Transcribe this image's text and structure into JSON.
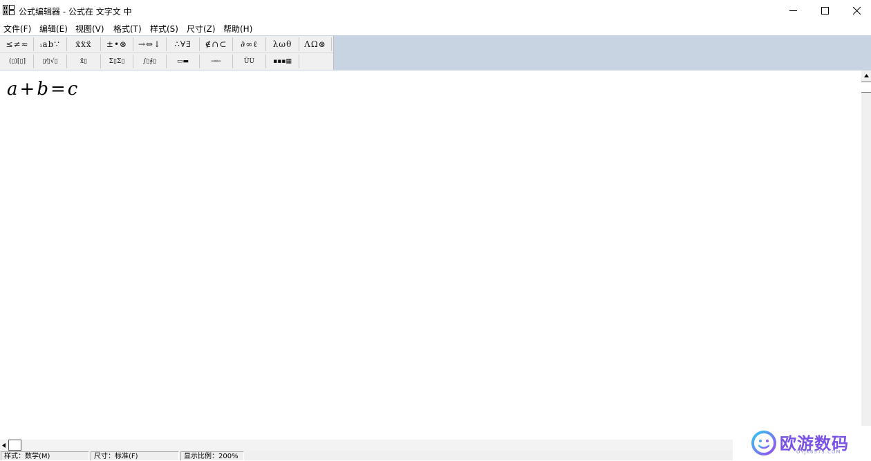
{
  "window": {
    "title": "公式编辑器 - 公式在 文字文 中",
    "minimize_label": "minimize",
    "maximize_label": "maximize",
    "close_label": "close"
  },
  "menu": [
    {
      "label": "文件(F)"
    },
    {
      "label": "编辑(E)"
    },
    {
      "label": "视图(V)"
    },
    {
      "label": "格式(T)"
    },
    {
      "label": "样式(S)"
    },
    {
      "label": "尺寸(Z)"
    },
    {
      "label": "帮助(H)"
    }
  ],
  "toolbar": {
    "row1": [
      {
        "symbols": "≤≠≈",
        "name": "relational-symbols"
      },
      {
        "symbols": "ᵢab∵",
        "name": "spaces-ellipses"
      },
      {
        "symbols": "ẍẍẍ",
        "name": "embellishments"
      },
      {
        "symbols": "±•⊗",
        "name": "operator-symbols"
      },
      {
        "symbols": "→⇔↓",
        "name": "arrow-symbols"
      },
      {
        "symbols": "∴∀∃",
        "name": "logical-symbols"
      },
      {
        "symbols": "∉∩⊂",
        "name": "set-theory-symbols"
      },
      {
        "symbols": "∂∞ℓ",
        "name": "misc-symbols"
      },
      {
        "symbols": "λωθ",
        "name": "greek-lowercase"
      },
      {
        "symbols": "ΛΩ⊗",
        "name": "greek-uppercase"
      }
    ],
    "row2": [
      {
        "symbols": "(▯)[▯]",
        "name": "fence-templates"
      },
      {
        "symbols": "▯⁄▯√▯",
        "name": "fraction-radical-templates"
      },
      {
        "symbols": "ẍ▯",
        "name": "subscript-superscript-templates"
      },
      {
        "symbols": "Σ▯Σ▯",
        "name": "summation-templates"
      },
      {
        "symbols": "∫▯∮▯",
        "name": "integral-templates"
      },
      {
        "symbols": "▭▬",
        "name": "underbar-overbar-templates"
      },
      {
        "symbols": "→←",
        "name": "labeled-arrow-templates"
      },
      {
        "symbols": "ŪÚ",
        "name": "products-set-templates"
      },
      {
        "symbols": "▪▪▪▦",
        "name": "matrix-templates"
      }
    ]
  },
  "formula": {
    "a": "a",
    "plus": "+",
    "b": "b",
    "eq": "=",
    "c": "c"
  },
  "status": {
    "style": "样式：数学(M)",
    "size": "尺寸：标准(F)",
    "zoom": "显示比例：200%"
  },
  "watermark": {
    "brand": "欧游数码",
    "url": "OYJK6573.COM",
    "accent_color": "#7a52e6"
  }
}
